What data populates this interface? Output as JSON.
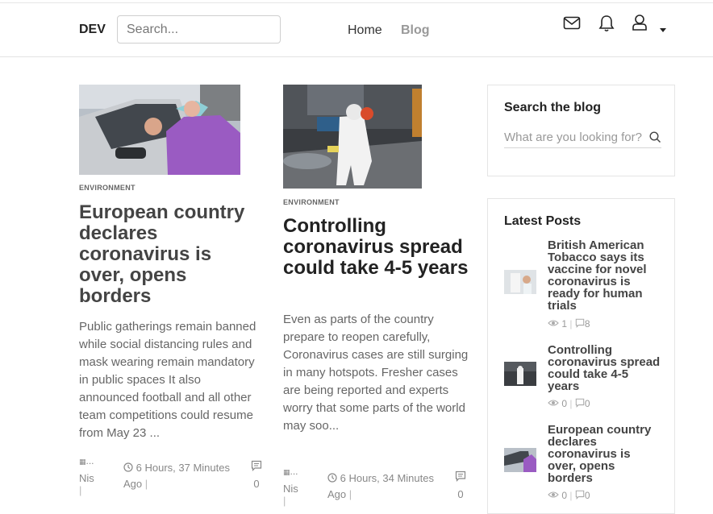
{
  "header": {
    "brand": "DEV",
    "search_placeholder": "Search...",
    "nav": [
      {
        "label": "Home"
      },
      {
        "label": "Blog"
      }
    ],
    "icons": [
      "mail-icon",
      "bell-icon",
      "user-icon",
      "caret-down-icon"
    ]
  },
  "posts": [
    {
      "category": "ENVIRONMENT",
      "title": "European country declares coronavirus is over, opens borders",
      "excerpt": "Public gatherings remain banned while social distancing rules and mask wearing remain mandatory in public spaces It also announced football and all other team competitions could resume from May 23 ...",
      "author_img_alt": "...",
      "author": "Nis",
      "time": "6 Hours, 37 Minutes",
      "time_suffix": "Ago",
      "comments": "0"
    },
    {
      "category": "ENVIRONMENT",
      "title": "Controlling coronavirus spread could take 4-5 years",
      "excerpt": "Even as parts of the country prepare to reopen carefully, Coronavirus cases are still surging in many hotspots. Fresher cases are being reported and experts worry that some parts of the world may soo...",
      "author_img_alt": "...",
      "author": "Nis",
      "time": "6 Hours, 34 Minutes",
      "time_suffix": "Ago",
      "comments": "0"
    }
  ],
  "sidebar": {
    "search": {
      "heading": "Search the blog",
      "placeholder": "What are you looking for?"
    },
    "latest": {
      "heading": "Latest Posts",
      "items": [
        {
          "title": "British American Tobacco says its vaccine for novel coronavirus is ready for human trials",
          "views": "1",
          "comments": "8"
        },
        {
          "title": "Controlling coronavirus spread could take 4-5 years",
          "views": "0",
          "comments": "0"
        },
        {
          "title": "European country declares coronavirus is over, opens borders",
          "views": "0",
          "comments": "0"
        }
      ]
    }
  },
  "separators": {
    "pipe": "|"
  }
}
